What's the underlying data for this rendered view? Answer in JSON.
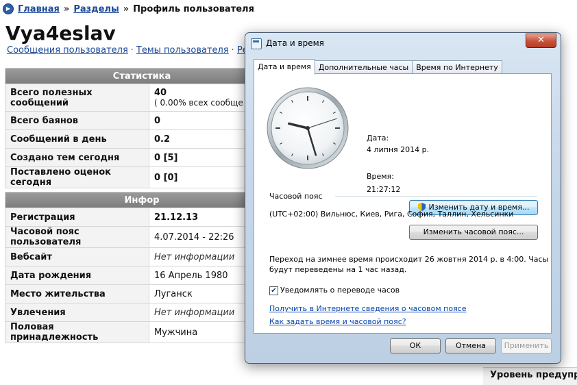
{
  "breadcrumb": {
    "home": "Главная",
    "separator": "»",
    "sections": "Разделы",
    "current": "Профиль пользователя"
  },
  "profile": {
    "username": "Vya4eslav",
    "links": [
      "Сообщения пользователя",
      "Темы пользователя",
      "Реда"
    ],
    "link_separator": "·"
  },
  "stats": {
    "header": "Статистика",
    "rows": [
      {
        "label": "Всего полезных сообщений",
        "value": "40",
        "extra": "( 0.00% всех сообще"
      },
      {
        "label": "Всего баянов",
        "value": "0"
      },
      {
        "label": "Сообщений в день",
        "value": "0.2"
      },
      {
        "label": "Создано тем сегодня",
        "value": "0 [5]"
      },
      {
        "label": "Поставлено оценок сегодня",
        "value": "0 [0]"
      }
    ]
  },
  "info": {
    "header": "Инфор",
    "rows": [
      {
        "label": "Регистрация",
        "value": "21.12.13"
      },
      {
        "label": "Часовой пояс пользователя",
        "value": "4.07.2014 - 22:26"
      },
      {
        "label": "Вебсайт",
        "value": "Нет информации"
      },
      {
        "label": "Дата рождения",
        "value": "16 Апрель 1980"
      },
      {
        "label": "Место жительства",
        "value": "Луганск"
      },
      {
        "label": "Увлечения",
        "value": "Нет информации"
      },
      {
        "label": "Половая принадлежность",
        "value": "Мужчина"
      }
    ]
  },
  "warning_label": "Уровень предупре",
  "dialog": {
    "title": "Дата и время",
    "close": "✕",
    "tabs": [
      "Дата и время",
      "Дополнительные часы",
      "Время по Интернету"
    ],
    "active_tab": 0,
    "clock": {
      "hours": 21,
      "minutes": 27,
      "seconds": 12
    },
    "date_label": "Дата:",
    "date_value": "4 липня 2014 р.",
    "time_label": "Время:",
    "time_value": "21:27:12",
    "change_datetime_button": "Изменить дату и время...",
    "timezone_label": "Часовой пояс",
    "timezone_value": "(UTC+02:00) Вильнюс, Киев, Рига, София, Таллин, Хельсинки",
    "change_timezone_button": "Изменить часовой пояс...",
    "dst_note_line1": "Переход на зимнее время происходит 26 жовтня 2014 р. в 4:00. Часы",
    "dst_note_line2": "будут переведены на 1 час назад.",
    "notify_checkbox_label": "Уведомлять о переводе часов",
    "notify_checked": true,
    "link_timezone_info": "Получить в Интернете сведения о часовом поясе",
    "link_how_to_set": "Как задать время и часовой пояс?",
    "ok_button": "ОК",
    "cancel_button": "Отмена",
    "apply_button": "Применить"
  }
}
